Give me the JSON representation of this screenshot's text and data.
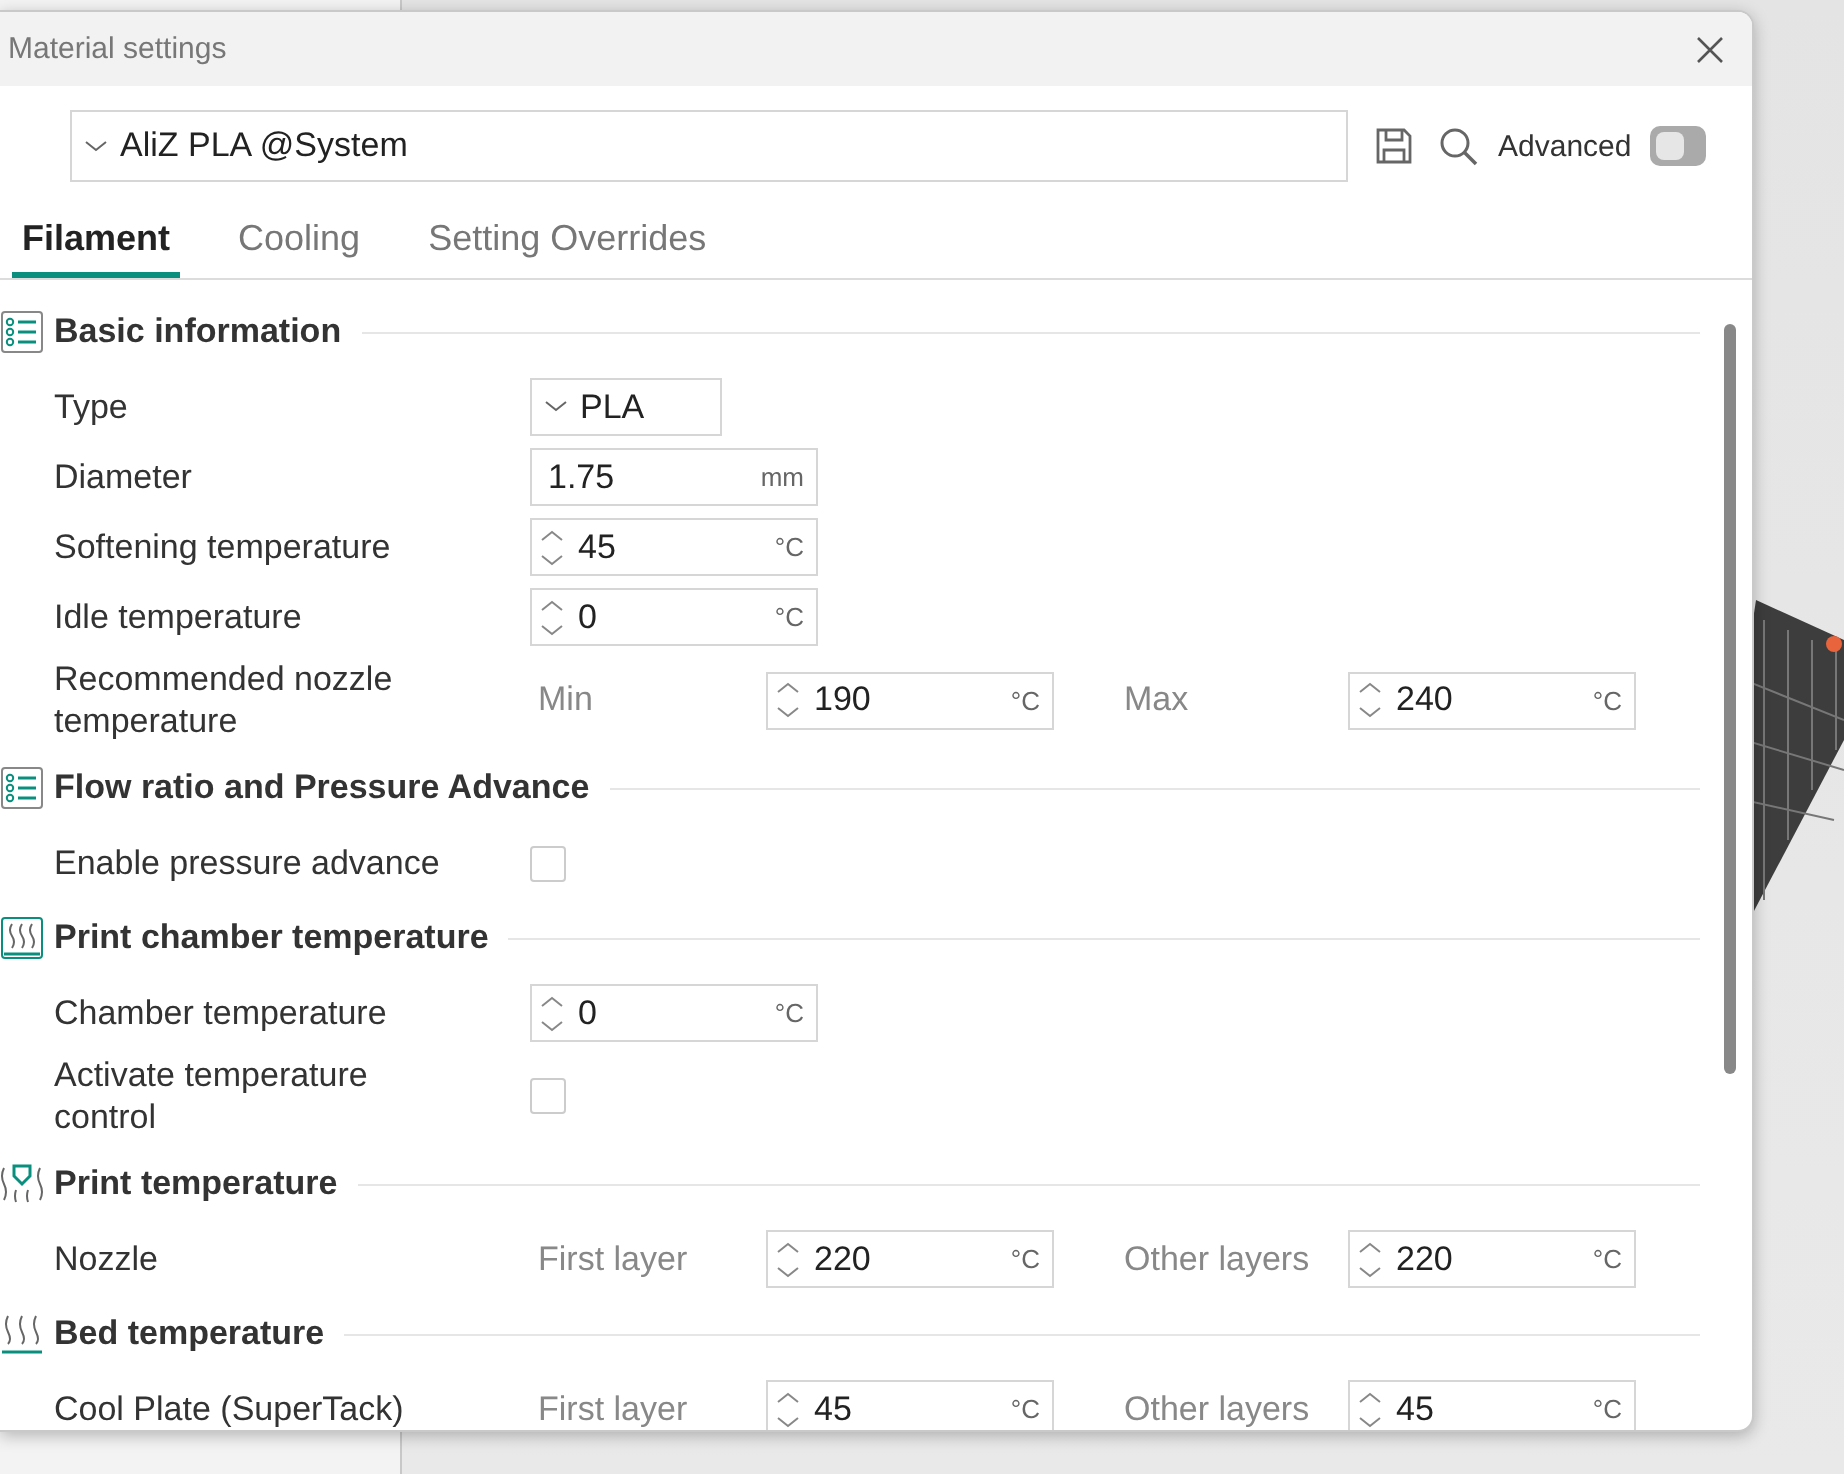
{
  "window": {
    "title": "Material settings"
  },
  "preset": {
    "value": "AliZ PLA @System"
  },
  "advanced": {
    "label": "Advanced",
    "on": false
  },
  "tabs": [
    {
      "label": "Filament",
      "selected": true
    },
    {
      "label": "Cooling",
      "selected": false
    },
    {
      "label": "Setting Overrides",
      "selected": false
    }
  ],
  "sections": [
    {
      "title": "Basic information",
      "kind": "list",
      "rows": [
        {
          "kind": "combo",
          "label": "Type",
          "value": "PLA"
        },
        {
          "kind": "field",
          "label": "Diameter",
          "fields": [
            {
              "value": "1.75",
              "unit": "mm",
              "spin": false
            }
          ]
        },
        {
          "kind": "field",
          "label": "Softening temperature",
          "fields": [
            {
              "value": "45",
              "unit": "°C",
              "spin": true
            }
          ]
        },
        {
          "kind": "field",
          "label": "Idle temperature",
          "fields": [
            {
              "value": "0",
              "unit": "°C",
              "spin": true
            }
          ]
        },
        {
          "kind": "field",
          "label": "Recommended nozzle temperature",
          "fields": [
            {
              "label": "Min",
              "value": "190",
              "unit": "°C",
              "spin": true
            },
            {
              "label": "Max",
              "value": "240",
              "unit": "°C",
              "spin": true
            }
          ]
        }
      ]
    },
    {
      "title": "Flow ratio and Pressure Advance",
      "kind": "list",
      "rows": [
        {
          "kind": "checkbox",
          "label": "Enable pressure advance",
          "checked": false
        }
      ]
    },
    {
      "title": "Print chamber temperature",
      "kind": "chamber",
      "rows": [
        {
          "kind": "field",
          "label": "Chamber temperature",
          "fields": [
            {
              "value": "0",
              "unit": "°C",
              "spin": true
            }
          ]
        },
        {
          "kind": "checkbox",
          "label": "Activate temperature control",
          "checked": false
        }
      ]
    },
    {
      "title": "Print temperature",
      "kind": "nozzle",
      "rows": [
        {
          "kind": "field",
          "label": "Nozzle",
          "fields": [
            {
              "label": "First layer",
              "value": "220",
              "unit": "°C",
              "spin": true
            },
            {
              "label": "Other layers",
              "value": "220",
              "unit": "°C",
              "spin": true
            }
          ]
        }
      ]
    },
    {
      "title": "Bed temperature",
      "kind": "bed",
      "rows": [
        {
          "kind": "field",
          "label": "Cool Plate (SuperTack)",
          "fields": [
            {
              "label": "First layer",
              "value": "45",
              "unit": "°C",
              "spin": true
            },
            {
              "label": "Other layers",
              "value": "45",
              "unit": "°C",
              "spin": true
            }
          ]
        }
      ]
    }
  ]
}
